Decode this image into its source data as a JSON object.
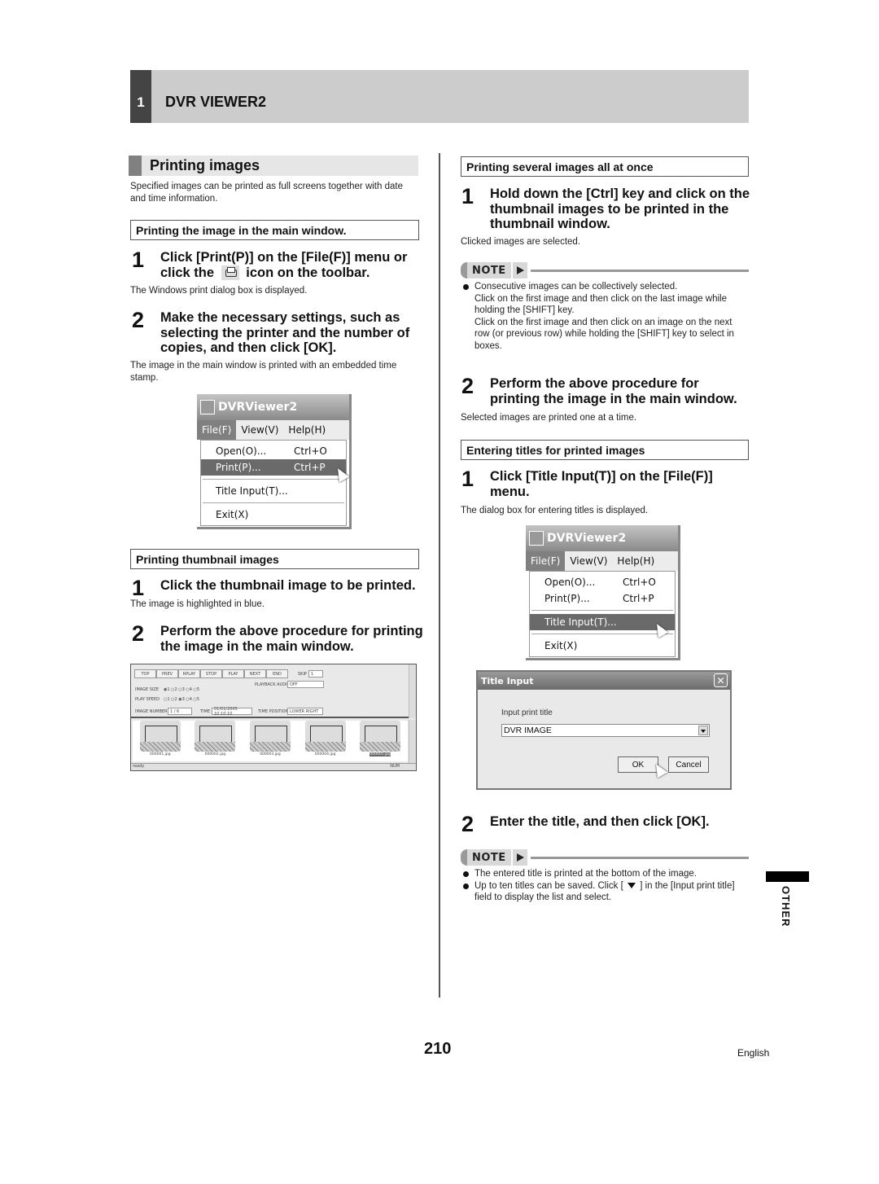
{
  "header": {
    "chapter_number": "1",
    "chapter_title": "DVR VIEWER2"
  },
  "left": {
    "section_title": "Printing images",
    "intro": "Specified images can be printed as full screens together with date and time information.",
    "sub1": {
      "heading": "Printing the image in the main window.",
      "step1": {
        "num": "1",
        "text_a": "Click [Print(P)] on the [File(F)] menu or",
        "text_b_pre": "click the",
        "text_b_post": "icon on the toolbar.",
        "desc": "The Windows print dialog box is displayed."
      },
      "step2": {
        "num": "2",
        "text": "Make the necessary settings, such as selecting the printer and the number of copies, and then click [OK].",
        "desc": "The image in the main window is printed with an embedded time stamp."
      }
    },
    "menu_shot": {
      "app_title": "DVRViewer2",
      "menubar": [
        "File(F)",
        "View(V)",
        "Help(H)"
      ],
      "items": [
        {
          "label": "Open(O)...",
          "shortcut": "Ctrl+O"
        },
        {
          "label": "Print(P)...",
          "shortcut": "Ctrl+P"
        },
        {
          "label": "Title Input(T)...",
          "shortcut": ""
        },
        {
          "label": "Exit(X)",
          "shortcut": ""
        }
      ],
      "highlighted": "Print(P)..."
    },
    "sub2": {
      "heading": "Printing thumbnail images",
      "step1": {
        "num": "1",
        "text": "Click the thumbnail image to be printed.",
        "desc": "The image is highlighted in blue."
      },
      "step2": {
        "num": "2",
        "text": "Perform the above procedure for printing the image in the main window."
      }
    },
    "app_shot": {
      "buttons": [
        "TOP",
        "PREV",
        "RPLAY",
        "STOP",
        "PLAY",
        "NEXT",
        "END"
      ],
      "skip_label": "SKIP",
      "skip_value": "1",
      "playback_audio_label": "PLAYBACK AUDIO",
      "playback_audio_value": "OFF",
      "image_size_label": "IMAGE SIZE",
      "image_size_options": [
        "1",
        "2",
        "3",
        "4",
        "5"
      ],
      "image_size_selected": "1",
      "play_speed_label": "PLAY SPEED",
      "play_speed_options": [
        "1",
        "2",
        "3",
        "4",
        "5"
      ],
      "play_speed_selected": "3",
      "image_number_label": "IMAGE NUMBER",
      "image_number_value": "1 / 6",
      "time_label": "TIME",
      "time_value": "01/01/2005 10:10:10",
      "time_position_label": "TIME POSITION",
      "time_position_value": "LOWER RIGHT",
      "thumbnails": [
        "000001.jpg",
        "000002.jpg",
        "000003.jpg",
        "000004.jpg",
        "000005.jpg"
      ],
      "selected_thumbnail": "000005.jpg",
      "status_text": "ready",
      "status_num": "NUM"
    }
  },
  "right": {
    "sub1": {
      "heading": "Printing several images all at once",
      "step1": {
        "num": "1",
        "text": "Hold down the [Ctrl] key and click on the thumbnail images to be printed in the thumbnail window.",
        "desc": "Clicked images are selected."
      },
      "note_label": "NOTE",
      "notes": [
        "Consecutive images can be collectively selected.\nClick on the first image and then click on the last image while holding the [SHIFT] key.\nClick on the first image and then click on an image on the next row (or previous row) while holding the [SHIFT] key to select in boxes."
      ],
      "step2": {
        "num": "2",
        "text": "Perform the above procedure for printing the image in the main window.",
        "desc": "Selected images are printed one at a time."
      }
    },
    "sub2": {
      "heading": "Entering titles for printed images",
      "step1": {
        "num": "1",
        "text": "Click [Title Input(T)] on the [File(F)] menu.",
        "desc": "The dialog box for entering titles is displayed."
      },
      "step2": {
        "num": "2",
        "text": "Enter the title, and then click [OK]."
      },
      "note_label": "NOTE",
      "note1": "The entered title is printed at the bottom of the image.",
      "note2_pre": "Up to ten titles can be saved. Click [",
      "note2_post": "] in the [Input print title] field to display the list and select."
    },
    "menu_shot": {
      "app_title": "DVRViewer2",
      "menubar": [
        "File(F)",
        "View(V)",
        "Help(H)"
      ],
      "items": [
        {
          "label": "Open(O)...",
          "shortcut": "Ctrl+O"
        },
        {
          "label": "Print(P)...",
          "shortcut": "Ctrl+P"
        },
        {
          "label": "Title Input(T)...",
          "shortcut": ""
        },
        {
          "label": "Exit(X)",
          "shortcut": ""
        }
      ],
      "highlighted": "Title Input(T)..."
    },
    "dialog": {
      "title": "Title Input",
      "field_label": "Input print title",
      "field_value": "DVR IMAGE",
      "ok_label": "OK",
      "cancel_label": "Cancel"
    }
  },
  "side_tab": "OTHER",
  "footer": {
    "page_number": "210",
    "language": "English"
  }
}
